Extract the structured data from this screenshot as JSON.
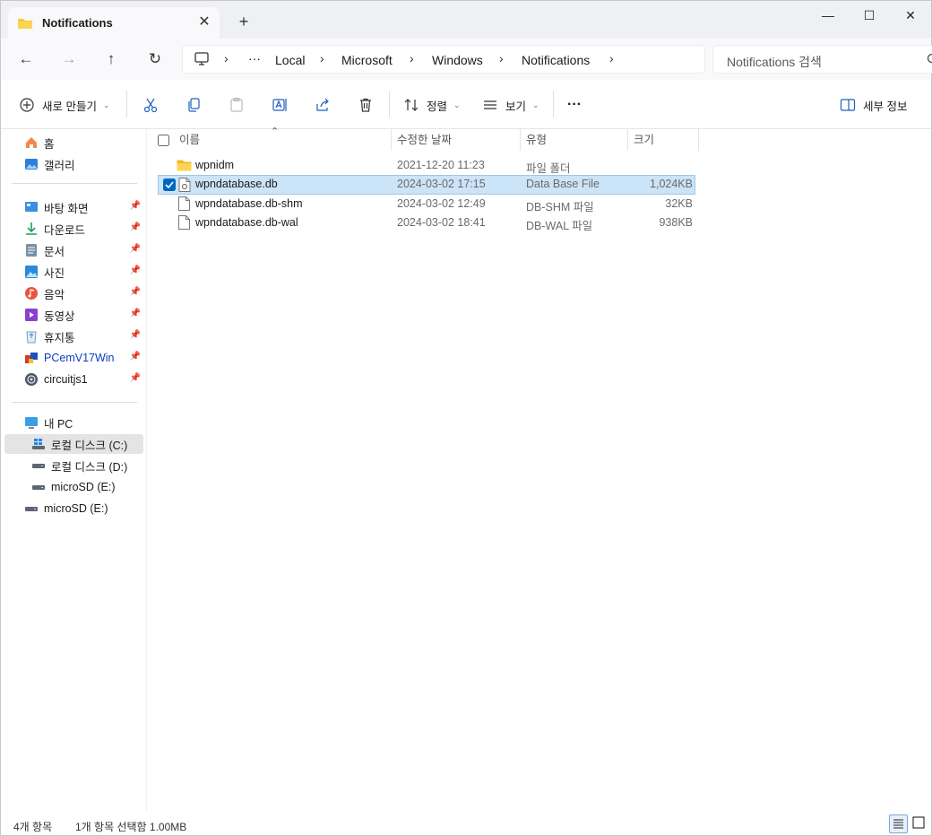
{
  "window": {
    "tab_title": "Notifications",
    "tab_close": "✕",
    "new_tab": "+",
    "minimize": "—",
    "maximize": "☐",
    "close": "✕"
  },
  "nav": {
    "back": "←",
    "forward": "→",
    "up": "↑",
    "refresh": "↻",
    "breadcrumbs": [
      "Local",
      "Microsoft",
      "Windows",
      "Notifications"
    ],
    "ellipsis": "···",
    "search_placeholder": "Notifications 검색"
  },
  "toolbar": {
    "new_label": "새로 만들기",
    "sort_label": "정렬",
    "view_label": "보기",
    "more": "···",
    "details_label": "세부 정보"
  },
  "sidebar": {
    "top": [
      {
        "label": "홈",
        "icon": "home-icon"
      },
      {
        "label": "갤러리",
        "icon": "gallery-icon"
      }
    ],
    "pinned": [
      {
        "label": "바탕 화면",
        "icon": "desktop-icon"
      },
      {
        "label": "다운로드",
        "icon": "download-icon"
      },
      {
        "label": "문서",
        "icon": "documents-icon"
      },
      {
        "label": "사진",
        "icon": "pictures-icon"
      },
      {
        "label": "음악",
        "icon": "music-icon"
      },
      {
        "label": "동영상",
        "icon": "videos-icon"
      },
      {
        "label": "휴지통",
        "icon": "recycle-bin-icon"
      },
      {
        "label": "PCemV17Win",
        "icon": "pcem-icon"
      },
      {
        "label": "circuitjs1",
        "icon": "circuitjs-icon"
      }
    ],
    "pc": [
      {
        "label": "내 PC",
        "icon": "this-pc-icon"
      },
      {
        "label": "로컬 디스크 (C:)",
        "icon": "drive-c-icon"
      },
      {
        "label": "로컬 디스크 (D:)",
        "icon": "drive-icon"
      },
      {
        "label": "microSD (E:)",
        "icon": "drive-icon"
      },
      {
        "label": "microSD (E:)",
        "icon": "drive-icon"
      }
    ]
  },
  "columns": {
    "name": "이름",
    "date": "수정한 날짜",
    "type": "유형",
    "size": "크기"
  },
  "files": [
    {
      "name": "wpnidm",
      "date": "2021-12-20 11:23",
      "type": "파일 폴더",
      "size": "",
      "icon": "folder-icon",
      "selected": false
    },
    {
      "name": "wpndatabase.db",
      "date": "2024-03-02 17:15",
      "type": "Data Base File",
      "size": "1,024KB",
      "icon": "database-file-icon",
      "selected": true
    },
    {
      "name": "wpndatabase.db-shm",
      "date": "2024-03-02 12:49",
      "type": "DB-SHM 파일",
      "size": "32KB",
      "icon": "file-icon",
      "selected": false
    },
    {
      "name": "wpndatabase.db-wal",
      "date": "2024-03-02 18:41",
      "type": "DB-WAL 파일",
      "size": "938KB",
      "icon": "file-icon",
      "selected": false
    }
  ],
  "status": {
    "count": "4개 항목",
    "selection": "1개 항목 선택함 1.00MB"
  },
  "colors": {
    "accent": "#0067c0",
    "selection_bg": "#cce4f7",
    "folder": "#f8c93b",
    "link_blue": "#0b3cc1"
  }
}
